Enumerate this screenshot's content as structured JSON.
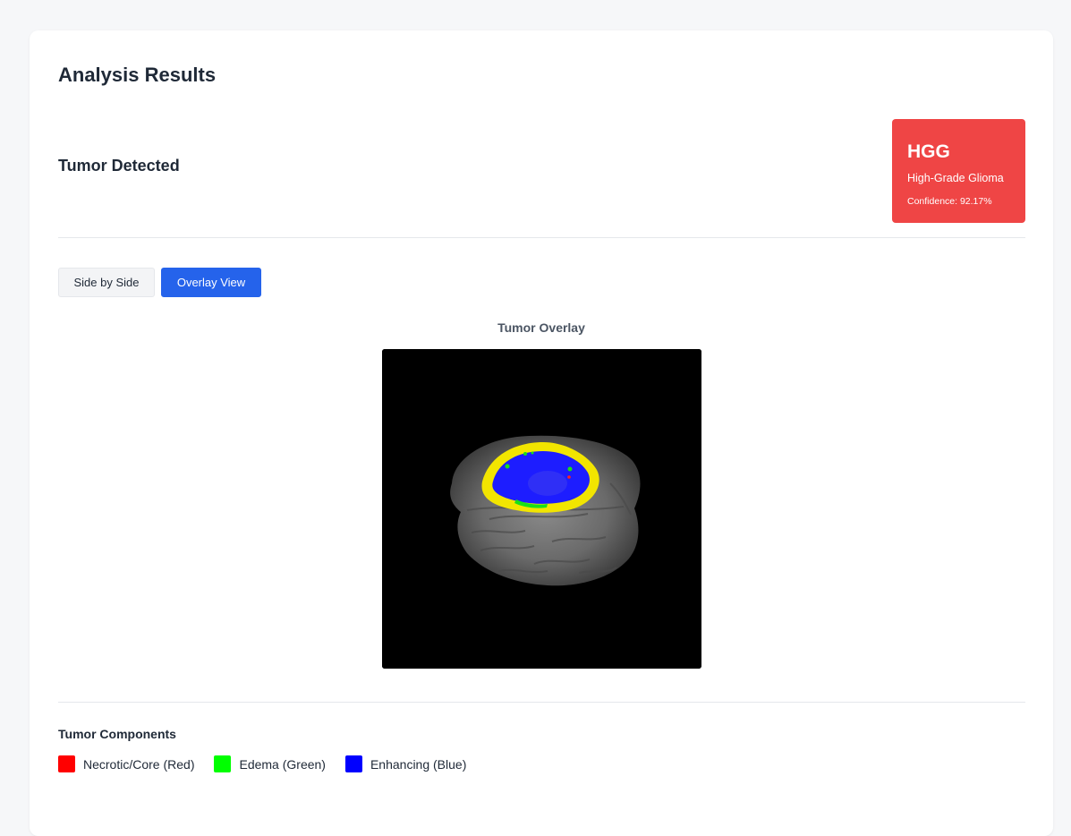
{
  "header": {
    "title": "Analysis Results"
  },
  "result": {
    "status": "Tumor Detected",
    "badge": {
      "code": "HGG",
      "name": "High-Grade Glioma",
      "confidence": "Confidence: 92.17%",
      "color": "#ef4545"
    }
  },
  "view_toggle": {
    "side_by_side": "Side by Side",
    "overlay": "Overlay View",
    "active": "overlay"
  },
  "overlay": {
    "title": "Tumor Overlay"
  },
  "legend": {
    "title": "Tumor Components",
    "items": [
      {
        "label": "Necrotic/Core (Red)",
        "color": "#ff0000"
      },
      {
        "label": "Edema (Green)",
        "color": "#00ff00"
      },
      {
        "label": "Enhancing (Blue)",
        "color": "#0000ff"
      }
    ]
  }
}
